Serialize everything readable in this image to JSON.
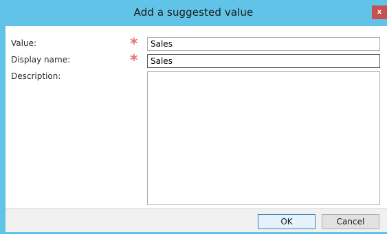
{
  "dialog": {
    "title": "Add a suggested value",
    "close_label": "x"
  },
  "fields": {
    "value": {
      "label": "Value:",
      "required_marker": "*",
      "current": "Sales"
    },
    "display_name": {
      "label": "Display name:",
      "required_marker": "*",
      "current": "Sales"
    },
    "description": {
      "label": "Description:",
      "current": ""
    }
  },
  "buttons": {
    "ok_label": "OK",
    "cancel_label": "Cancel"
  },
  "colors": {
    "titlebar": "#60c3e7",
    "required_marker": "#e57373",
    "close_button": "#c75050"
  }
}
